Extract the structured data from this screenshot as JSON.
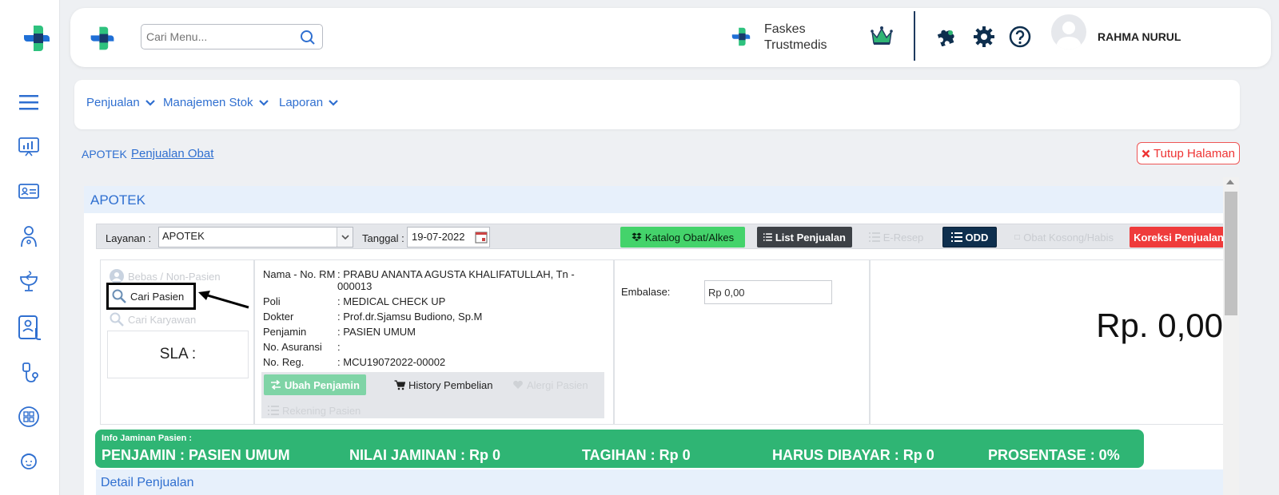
{
  "header": {
    "search_placeholder": "Cari Menu...",
    "faskes_line1": "Faskes",
    "faskes_line2": "Trustmedis",
    "username": "RAHMA NURUL"
  },
  "menu": [
    {
      "label": "Penjualan"
    },
    {
      "label": "Manajemen Stok"
    },
    {
      "label": "Laporan"
    }
  ],
  "breadcrumb": {
    "root": "APOTEK",
    "current": "Penjualan Obat"
  },
  "close_label": "Tutup Halaman",
  "panel": {
    "title": "APOTEK",
    "layanan_label": "Layanan :",
    "layanan_value": "APOTEK",
    "tanggal_label": "Tanggal :",
    "tanggal_value": "19-07-2022",
    "buttons": {
      "katalog": "Katalog Obat/Alkes",
      "list_penjualan": "List Penjualan",
      "e_resep": "E-Resep",
      "odd": "ODD",
      "obat_kosong": "Obat Kosong/Habis",
      "koreksi": "Koreksi Penjualan"
    }
  },
  "patient_select": {
    "option_bebas": "Bebas / Non-Pasien",
    "option_cari_pasien": "Cari Pasien",
    "option_cari_karyawan": "Cari Karyawan",
    "sla_label": "SLA :"
  },
  "patient_info": {
    "rows": [
      {
        "label": "Nama - No. RM",
        "value": "PRABU ANANTA AGUSTA KHALIFATULLAH, Tn - 000013"
      },
      {
        "label": "Poli",
        "value": "MEDICAL CHECK UP"
      },
      {
        "label": "Dokter",
        "value": "Prof.dr.Sjamsu Budiono, Sp.M"
      },
      {
        "label": "Penjamin",
        "value": "PASIEN UMUM"
      },
      {
        "label": "No. Asuransi",
        "value": ""
      },
      {
        "label": "No. Reg.",
        "value": "MCU19072022-00002"
      }
    ],
    "btn_ubah": "Ubah Penjamin",
    "btn_history": "History Pembelian",
    "btn_alergi": "Alergi Pasien",
    "btn_rekening": "Rekening Pasien"
  },
  "embalase": {
    "label": "Embalase:",
    "value": "Rp 0,00"
  },
  "total": "Rp. 0,00",
  "jaminan": {
    "title": "Info Jaminan Pasien :",
    "items": [
      "PENJAMIN : PASIEN UMUM",
      "NILAI JAMINAN : Rp 0",
      "TAGIHAN : Rp 0",
      "HARUS DIBAYAR : Rp 0",
      "PROSENTASE : 0%"
    ]
  },
  "detail_title": "Detail Penjualan",
  "colors": {
    "brand_blue": "#2f6fd0",
    "brand_green": "#2fb574",
    "navy": "#0e2f4e",
    "danger": "#ef3b3b"
  }
}
